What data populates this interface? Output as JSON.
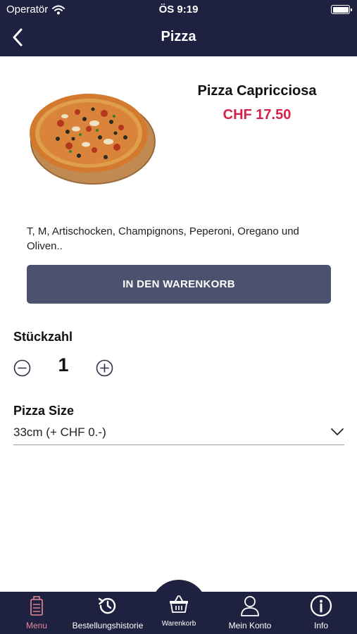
{
  "status_bar": {
    "carrier": "Operatör",
    "time": "ÖS 9:19"
  },
  "nav": {
    "title": "Pizza"
  },
  "product": {
    "name": "Pizza Capricciosa",
    "price": "CHF 17.50",
    "description": "T, M, Artischocken, Champignons, Peperoni, Oregano und Oliven..",
    "add_to_cart_label": "IN DEN WARENKORB"
  },
  "quantity": {
    "label": "Stückzahl",
    "value": "1"
  },
  "size": {
    "label": "Pizza Size",
    "selected": "33cm (+ CHF 0.-)"
  },
  "tabbar": {
    "items": [
      {
        "label": "Menu",
        "icon": "menu-card-icon",
        "active": true
      },
      {
        "label": "Bestellungshistorie",
        "icon": "history-icon",
        "active": false
      },
      {
        "label": "Warenkorb",
        "icon": "basket-icon",
        "active": false
      },
      {
        "label": "Mein Konto",
        "icon": "user-icon",
        "active": false
      },
      {
        "label": "Info",
        "icon": "info-icon",
        "active": false
      }
    ]
  },
  "colors": {
    "nav_background": "#1e2240",
    "price": "#d4234a",
    "button": "#4d5170",
    "active_tab": "#e58a98"
  }
}
